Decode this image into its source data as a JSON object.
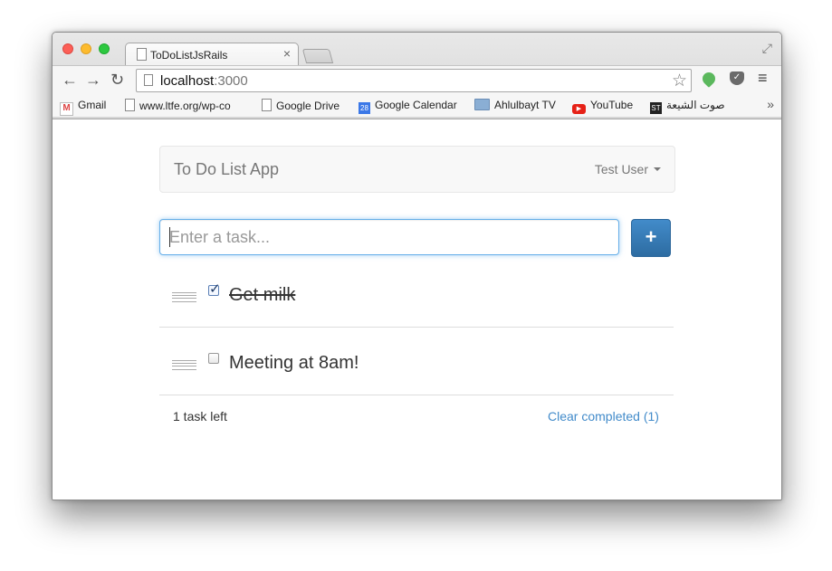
{
  "browser": {
    "tab_title": "ToDoListJsRails",
    "tab_close": "×",
    "url_host": "localhost",
    "url_port": ":3000",
    "bookmarks": [
      {
        "label": "Gmail",
        "icon": "gmail-icon",
        "glyph": "M"
      },
      {
        "label": "www.ltfe.org/wp-co",
        "icon": "page-icon",
        "glyph": ""
      },
      {
        "label": "Google Drive",
        "icon": "page-icon",
        "glyph": ""
      },
      {
        "label": "Google Calendar",
        "icon": "calendar-icon",
        "glyph": "28"
      },
      {
        "label": "Ahlulbayt TV",
        "icon": "folder-icon",
        "glyph": ""
      },
      {
        "label": "YouTube",
        "icon": "youtube-icon",
        "glyph": "▶"
      },
      {
        "label": "صوت الشيعة",
        "icon": "st-icon",
        "glyph": "ST"
      }
    ],
    "bookmarks_more": "»"
  },
  "app": {
    "brand": "To Do List App",
    "user": "Test User",
    "input_placeholder": "Enter a task...",
    "add_button": "+",
    "tasks": [
      {
        "text": "Get milk",
        "completed": true
      },
      {
        "text": "Meeting at 8am!",
        "completed": false
      }
    ],
    "tasks_left": "1 task left",
    "clear_completed": "Clear completed (1)"
  },
  "colors": {
    "primary": "#428bca",
    "focus_border": "#66afe9",
    "navbar_bg": "#f8f8f8"
  }
}
